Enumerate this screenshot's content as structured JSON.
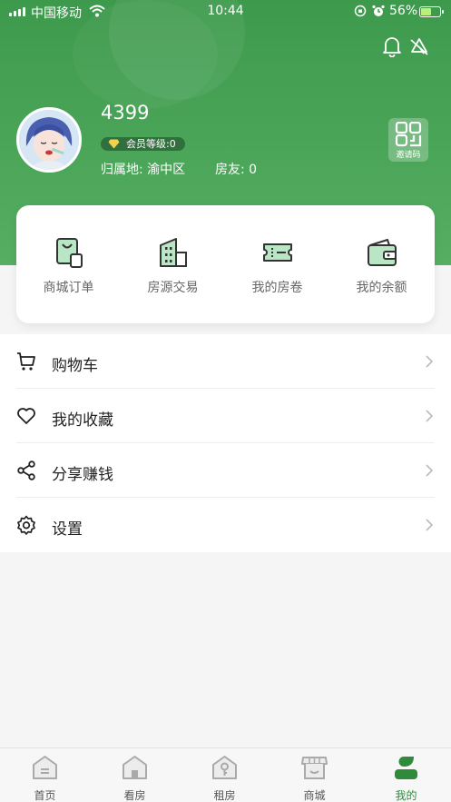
{
  "status_bar": {
    "carrier": "中国移动",
    "time": "10:44",
    "battery_pct": "56%",
    "battery_level": 0.56
  },
  "profile": {
    "username": "4399",
    "member_level": "会员等级:0",
    "location": "归属地: 渝中区",
    "friends": "房友: 0",
    "invite_label": "邀请码"
  },
  "quick_actions": [
    {
      "label": "商城订单",
      "icon": "shopping-bag-icon"
    },
    {
      "label": "房源交易",
      "icon": "building-icon"
    },
    {
      "label": "我的房卷",
      "icon": "ticket-icon"
    },
    {
      "label": "我的余额",
      "icon": "wallet-icon"
    }
  ],
  "menu": [
    {
      "label": "购物车",
      "icon": "cart-icon"
    },
    {
      "label": "我的收藏",
      "icon": "heart-icon"
    },
    {
      "label": "分享赚钱",
      "icon": "share-icon"
    },
    {
      "label": "设置",
      "icon": "gear-icon"
    }
  ],
  "tabbar": [
    {
      "label": "首页",
      "icon": "home-icon",
      "active": false
    },
    {
      "label": "看房",
      "icon": "house-view-icon",
      "active": false
    },
    {
      "label": "租房",
      "icon": "key-icon",
      "active": false
    },
    {
      "label": "商城",
      "icon": "store-icon",
      "active": false
    },
    {
      "label": "我的",
      "icon": "profile-icon",
      "active": true
    }
  ],
  "colors": {
    "brand_green": "#3d9a4c",
    "active_tab": "#2f8a3c",
    "icon_accent": "#b9e6c4"
  }
}
